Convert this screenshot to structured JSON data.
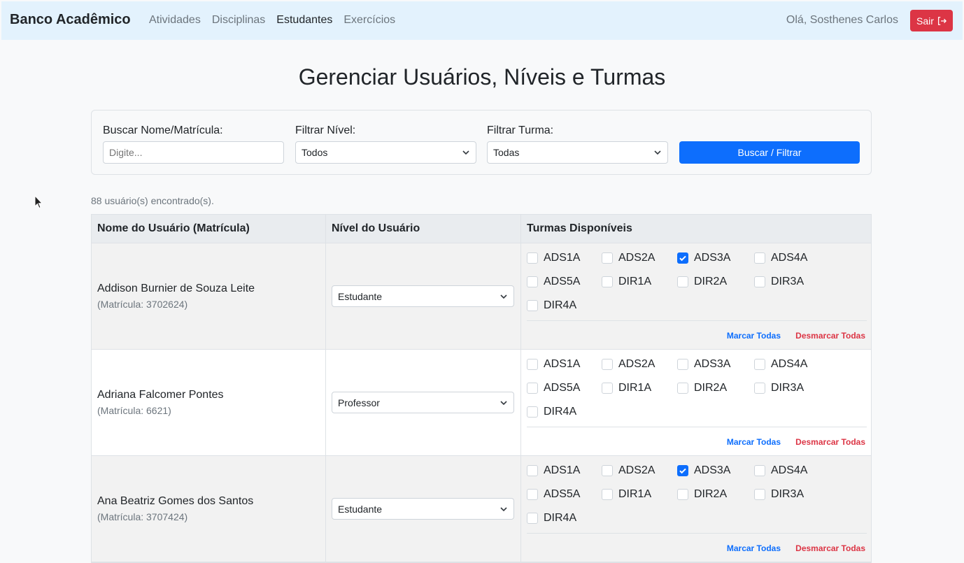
{
  "navbar": {
    "brand": "Banco Acadêmico",
    "links": [
      {
        "label": "Atividades"
      },
      {
        "label": "Disciplinas"
      },
      {
        "label": "Estudantes"
      },
      {
        "label": "Exercícios"
      }
    ],
    "greeting": "Olá, Sosthenes Carlos",
    "logout_label": "Sair"
  },
  "page": {
    "title": "Gerenciar Usuários, Níveis e Turmas"
  },
  "filters": {
    "search_label": "Buscar Nome/Matrícula:",
    "search_placeholder": "Digite...",
    "level_label": "Filtrar Nível:",
    "level_value": "Todos",
    "class_label": "Filtrar Turma:",
    "class_value": "Todas",
    "submit_label": "Buscar / Filtrar"
  },
  "result_count": "88 usuário(s) encontrado(s).",
  "table": {
    "headers": [
      "Nome do Usuário (Matrícula)",
      "Nível do Usuário",
      "Turmas Disponíveis"
    ],
    "mark_all_label": "Marcar Todas",
    "unmark_all_label": "Desmarcar Todas",
    "rows": [
      {
        "name": "Addison Burnier de Souza Leite",
        "matricula": "(Matrícula: 3702624)",
        "level": "Estudante",
        "classes": [
          {
            "label": "ADS1A",
            "checked": false
          },
          {
            "label": "ADS2A",
            "checked": false
          },
          {
            "label": "ADS3A",
            "checked": true
          },
          {
            "label": "ADS4A",
            "checked": false
          },
          {
            "label": "ADS5A",
            "checked": false
          },
          {
            "label": "DIR1A",
            "checked": false
          },
          {
            "label": "DIR2A",
            "checked": false
          },
          {
            "label": "DIR3A",
            "checked": false
          },
          {
            "label": "DIR4A",
            "checked": false
          }
        ]
      },
      {
        "name": "Adriana Falcomer Pontes",
        "matricula": "(Matrícula: 6621)",
        "level": "Professor",
        "classes": [
          {
            "label": "ADS1A",
            "checked": false
          },
          {
            "label": "ADS2A",
            "checked": false
          },
          {
            "label": "ADS3A",
            "checked": false
          },
          {
            "label": "ADS4A",
            "checked": false
          },
          {
            "label": "ADS5A",
            "checked": false
          },
          {
            "label": "DIR1A",
            "checked": false
          },
          {
            "label": "DIR2A",
            "checked": false
          },
          {
            "label": "DIR3A",
            "checked": false
          },
          {
            "label": "DIR4A",
            "checked": false
          }
        ]
      },
      {
        "name": "Ana Beatriz Gomes dos Santos",
        "matricula": "(Matrícula: 3707424)",
        "level": "Estudante",
        "classes": [
          {
            "label": "ADS1A",
            "checked": false
          },
          {
            "label": "ADS2A",
            "checked": false
          },
          {
            "label": "ADS3A",
            "checked": true
          },
          {
            "label": "ADS4A",
            "checked": false
          },
          {
            "label": "ADS5A",
            "checked": false
          },
          {
            "label": "DIR1A",
            "checked": false
          },
          {
            "label": "DIR2A",
            "checked": false
          },
          {
            "label": "DIR3A",
            "checked": false
          },
          {
            "label": "DIR4A",
            "checked": false
          }
        ]
      }
    ]
  },
  "colors": {
    "navbar_bg": "#e3f2fd",
    "primary": "#0d6efd",
    "danger": "#dc3545"
  }
}
